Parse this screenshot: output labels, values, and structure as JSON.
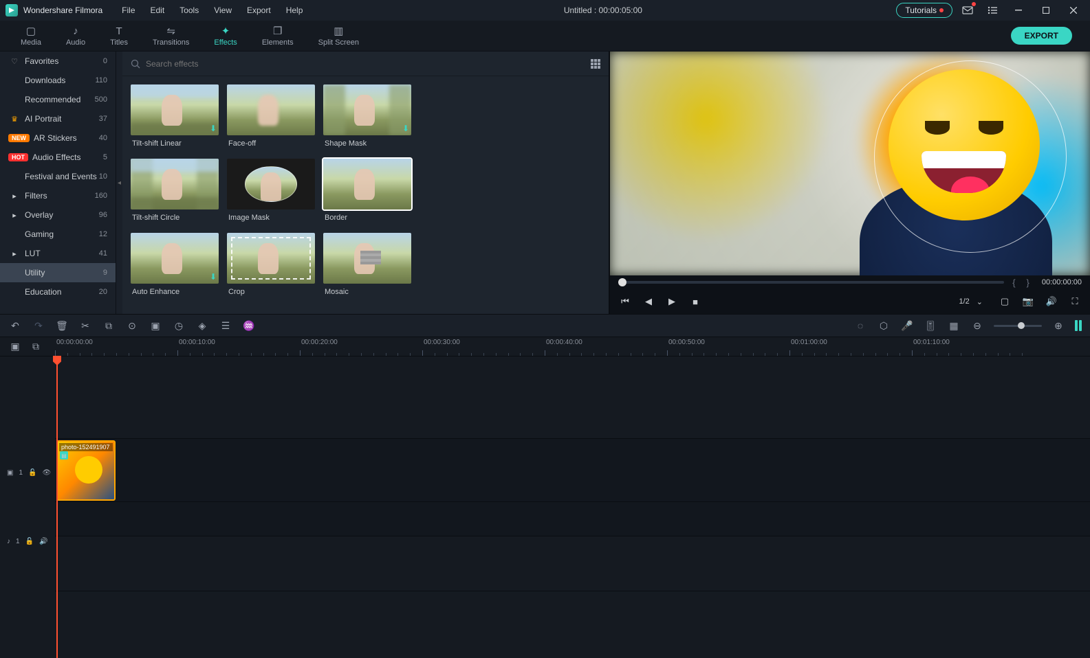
{
  "app": {
    "name": "Wondershare Filmora"
  },
  "menu": [
    "File",
    "Edit",
    "Tools",
    "View",
    "Export",
    "Help"
  ],
  "title_center": "Untitled : 00:00:05:00",
  "tutorials_label": "Tutorials",
  "tabs": [
    {
      "label": "Media",
      "icon": "folder"
    },
    {
      "label": "Audio",
      "icon": "music"
    },
    {
      "label": "Titles",
      "icon": "text"
    },
    {
      "label": "Transitions",
      "icon": "transition"
    },
    {
      "label": "Effects",
      "icon": "effect",
      "active": true
    },
    {
      "label": "Elements",
      "icon": "elements"
    },
    {
      "label": "Split Screen",
      "icon": "split"
    }
  ],
  "export_label": "EXPORT",
  "sidebar": {
    "items": [
      {
        "label": "Favorites",
        "count": "0",
        "icon": "heart"
      },
      {
        "label": "Downloads",
        "count": "110"
      },
      {
        "label": "Recommended",
        "count": "500"
      },
      {
        "label": "AI Portrait",
        "count": "37",
        "icon": "crown"
      },
      {
        "label": "AR Stickers",
        "count": "40",
        "badge": "NEW"
      },
      {
        "label": "Audio Effects",
        "count": "5",
        "badge": "HOT"
      },
      {
        "label": "Festival and Events",
        "count": "10"
      },
      {
        "label": "Filters",
        "count": "160",
        "arrow": true
      },
      {
        "label": "Overlay",
        "count": "96",
        "arrow": true
      },
      {
        "label": "Gaming",
        "count": "12"
      },
      {
        "label": "LUT",
        "count": "41",
        "arrow": true
      },
      {
        "label": "Utility",
        "count": "9",
        "selected": true
      },
      {
        "label": "Education",
        "count": "20"
      }
    ]
  },
  "search_placeholder": "Search effects",
  "effects": [
    {
      "label": "Tilt-shift Linear",
      "download": true
    },
    {
      "label": "Face-off"
    },
    {
      "label": "Shape Mask",
      "download": true
    },
    {
      "label": "Tilt-shift Circle"
    },
    {
      "label": "Image Mask"
    },
    {
      "label": "Border",
      "selected": true
    },
    {
      "label": "Auto Enhance",
      "download": true
    },
    {
      "label": "Crop"
    },
    {
      "label": "Mosaic"
    }
  ],
  "preview": {
    "time": "00:00:00:00",
    "ratio": "1/2"
  },
  "timeline": {
    "ticks": [
      "00:00:00:00",
      "00:00:10:00",
      "00:00:20:00",
      "00:00:30:00",
      "00:00:40:00",
      "00:00:50:00",
      "00:01:00:00",
      "00:01:10:00"
    ],
    "video_track_label": "1",
    "audio_track_label": "1",
    "clip_label": "photo-152491907"
  }
}
